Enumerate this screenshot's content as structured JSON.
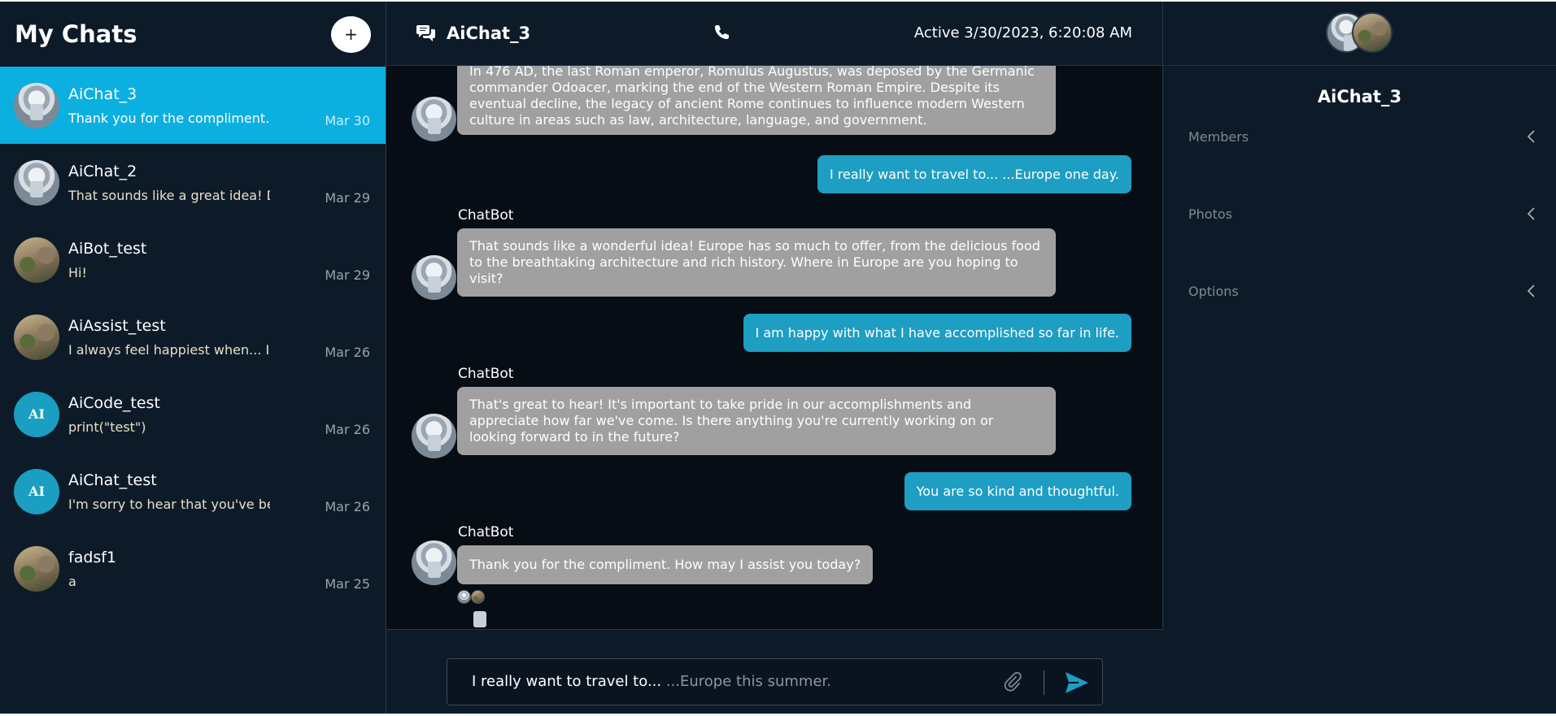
{
  "sidebar": {
    "title": "My Chats",
    "add_label": "+",
    "chats": [
      {
        "name": "AiChat_3",
        "preview": "Thank you for the compliment. How may I assist you today?",
        "date": "Mar 30",
        "avatar": "robot",
        "active": true
      },
      {
        "name": "AiChat_2",
        "preview": "That sounds like a great idea! Do you have any",
        "date": "Mar 29",
        "avatar": "robot",
        "active": false
      },
      {
        "name": "AiBot_test",
        "preview": "Hi!",
        "date": "Mar 29",
        "avatar": "photo",
        "active": false
      },
      {
        "name": "AiAssist_test",
        "preview": "I always feel happiest when... I always feel",
        "date": "Mar 26",
        "avatar": "photo",
        "active": false
      },
      {
        "name": "AiCode_test",
        "preview": "print(\"test\")",
        "date": "Mar 26",
        "avatar": "AI",
        "active": false
      },
      {
        "name": "AiChat_test",
        "preview": "I'm sorry to hear that you've been feeling",
        "date": "Mar 26",
        "avatar": "AI",
        "active": false
      },
      {
        "name": "fadsf1",
        "preview": "a",
        "date": "Mar 25",
        "avatar": "photo",
        "active": false
      }
    ]
  },
  "header": {
    "title": "AiChat_3",
    "status": "Active 3/30/2023, 6:20:08 AM",
    "chat_icon": "chat-bubbles-icon",
    "call_icon": "phone-icon"
  },
  "messages": [
    {
      "from": "bot",
      "sender": "",
      "text": "In 476 AD, the last Roman emperor, Romulus Augustus, was deposed by the Germanic commander Odoacer, marking the end of the Western Roman Empire. Despite its eventual decline, the legacy of ancient Rome continues to influence modern Western culture in areas such as law, architecture, language, and government."
    },
    {
      "from": "user",
      "text": "I really want to travel to... ...Europe one day."
    },
    {
      "from": "bot",
      "sender": "ChatBot",
      "text": "That sounds like a wonderful idea! Europe has so much to offer, from the delicious food to the breathtaking architecture and rich history. Where in Europe are you hoping to visit?"
    },
    {
      "from": "user",
      "text": "I am happy with what I have accomplished so far in life."
    },
    {
      "from": "bot",
      "sender": "ChatBot",
      "text": "That's great to hear! It's important to take pride in our accomplishments and appreciate how far we've come. Is there anything you're currently working on or looking forward to in the future?"
    },
    {
      "from": "user",
      "text": "You are so kind and thoughtful."
    },
    {
      "from": "bot",
      "sender": "ChatBot",
      "text": "Thank you for the compliment. How may I assist you today?"
    }
  ],
  "composer": {
    "typed": "I really want to travel to...",
    "placeholder": " ...Europe this summer.",
    "attach_icon": "paperclip-icon",
    "send_icon": "send-icon"
  },
  "details": {
    "title": "AiChat_3",
    "sections": [
      "Members",
      "Photos",
      "Options"
    ]
  },
  "colors": {
    "accent": "#0bb0e0",
    "user_bubble": "#1e9ec2",
    "bot_bubble": "#a0a0a0",
    "panel": "#0d1b29",
    "chat_bg": "#070d14"
  }
}
